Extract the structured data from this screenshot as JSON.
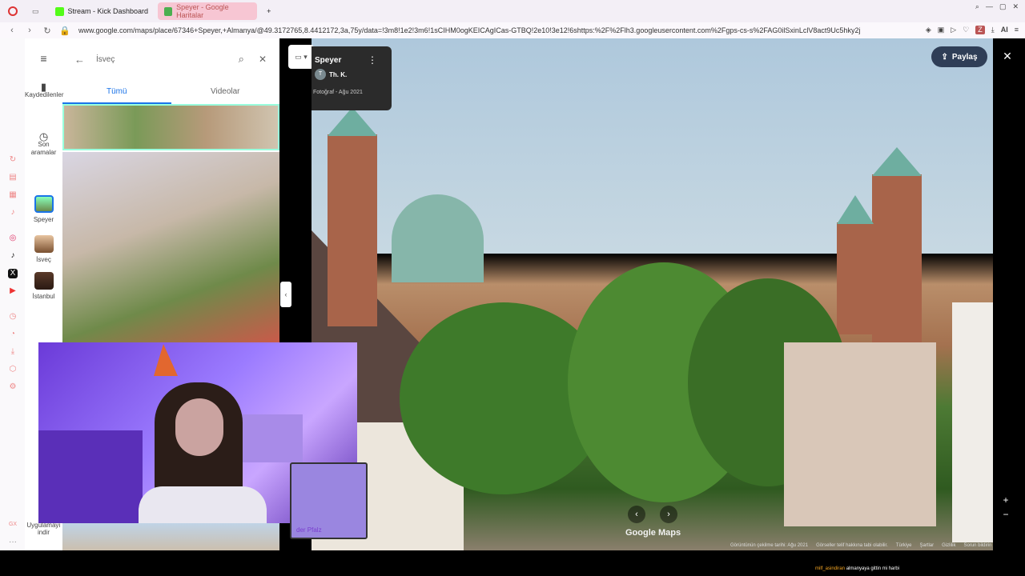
{
  "browser": {
    "tabs": [
      {
        "label": "Stream - Kick Dashboard",
        "active": false
      },
      {
        "label": "Speyer - Google Haritalar",
        "active": true
      }
    ],
    "new_tab_symbol": "+",
    "url": "www.google.com/maps/place/67346+Speyer,+Almanya/@49.3172765,8.4412172,3a,75y/data=!3m8!1e2!3m6!1sCIHM0ogKEICAgICas-GTBQ!2e10!3e12!6shttps:%2F%2Flh3.googleusercontent.com%2Fgps-cs-s%2FAG0ilSxinLclV8act9Uc5hky2j",
    "ai_label": "AI"
  },
  "maps": {
    "search": {
      "value": "İsveç"
    },
    "tabs": [
      {
        "label": "Tümü",
        "selected": true
      },
      {
        "label": "Videolar",
        "selected": false
      }
    ],
    "nav": [
      {
        "label": "Kaydedilenler",
        "icon": "bookmark-icon"
      },
      {
        "label": "Son aramalar",
        "icon": "history-icon"
      },
      {
        "label": "Speyer",
        "icon": "place-thumb"
      },
      {
        "label": "İsveç",
        "icon": "place-thumb"
      },
      {
        "label": "İstanbul",
        "icon": "place-thumb"
      }
    ],
    "uyg": "Uygulamayı indir",
    "photo_card": {
      "title": "Speyer",
      "author_initial": "T",
      "author": "Th. K.",
      "date": "Fotoğraf - Ağu 2021"
    },
    "share_label": "Paylaş",
    "logo": "Google Maps",
    "footer": [
      "Görüntünün çekilme tarihi: Ağu 2021",
      "Görseller telif hakkına tabi olabilir.",
      "Türkiye",
      "Şartlar",
      "Gizlilik",
      "Sorun bildirin"
    ],
    "pfalz_label": "der Pfalz"
  },
  "overlay": {
    "chat_user": "milf_asindiran",
    "chat_message": "almanyaya gittin mi harbi"
  },
  "colors": {
    "kick_green": "#53fc18",
    "maps_blue": "#1a73e8",
    "share_bg": "#2f3e57"
  }
}
